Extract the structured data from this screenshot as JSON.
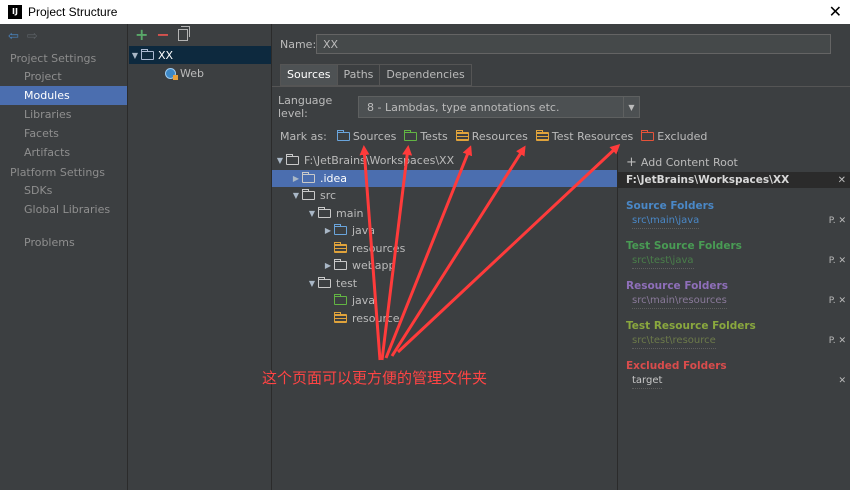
{
  "window": {
    "logo_text": "IJ",
    "title": "Project Structure",
    "close_glyph": "✕"
  },
  "nav": {
    "back_glyph": "⇦",
    "forward_glyph": "⇨",
    "project_settings_header": "Project Settings",
    "project_settings_items": [
      "Project",
      "Modules",
      "Libraries",
      "Facets",
      "Artifacts"
    ],
    "platform_settings_header": "Platform Settings",
    "platform_settings_items": [
      "SDKs",
      "Global Libraries"
    ],
    "problems_label": "Problems",
    "selected_item": "Modules"
  },
  "modules": {
    "toolbar": {
      "add_glyph": "+",
      "remove_glyph": "−"
    },
    "tree": [
      {
        "label": "XX",
        "expanded": true,
        "selected": true,
        "icon": "module-folder-icon"
      },
      {
        "label": "Web",
        "icon": "web-facet-icon"
      }
    ]
  },
  "main": {
    "name_label": "Name:",
    "name_value": "XX",
    "tabs": [
      "Sources",
      "Paths",
      "Dependencies"
    ],
    "active_tab": "Sources",
    "language_level_label": "Language level:",
    "language_level_value": "8 - Lambdas, type annotations etc.",
    "mark_as_label": "Mark as:",
    "mark_as_buttons": [
      {
        "label": "Sources",
        "color": "#6aa5dc"
      },
      {
        "label": "Tests",
        "color": "#62b543"
      },
      {
        "label": "Resources",
        "color": "#e0a33b"
      },
      {
        "label": "Test Resources",
        "color": "#e0a33b"
      },
      {
        "label": "Excluded",
        "color": "#e5533a"
      }
    ]
  },
  "file_tree": [
    {
      "label": "F:\\JetBrains\\Workspaces\\XX",
      "depth": 0,
      "toggle": "▼",
      "icon": "folder"
    },
    {
      "label": ".idea",
      "depth": 1,
      "toggle": "▶",
      "icon": "folder",
      "selected": true
    },
    {
      "label": "src",
      "depth": 1,
      "toggle": "▼",
      "icon": "folder"
    },
    {
      "label": "main",
      "depth": 2,
      "toggle": "▼",
      "icon": "folder"
    },
    {
      "label": "java",
      "depth": 3,
      "toggle": "▶",
      "icon": "source-folder"
    },
    {
      "label": "resources",
      "depth": 3,
      "toggle": "",
      "icon": "resource-folder"
    },
    {
      "label": "webapp",
      "depth": 3,
      "toggle": "▶",
      "icon": "folder"
    },
    {
      "label": "test",
      "depth": 2,
      "toggle": "▼",
      "icon": "folder"
    },
    {
      "label": "java",
      "depth": 3,
      "toggle": "",
      "icon": "test-folder"
    },
    {
      "label": "resource",
      "depth": 3,
      "toggle": "",
      "icon": "resource-folder"
    }
  ],
  "content_root": {
    "add_label": "Add Content Root",
    "root_path": "F:\\JetBrains\\Workspaces\\XX",
    "categories": [
      {
        "title": "Source Folders",
        "path": "src\\main\\java",
        "kind": "src"
      },
      {
        "title": "Test Source Folders",
        "path": "src\\test\\java",
        "kind": "test"
      },
      {
        "title": "Resource Folders",
        "path": "src\\main\\resources",
        "kind": "res"
      },
      {
        "title": "Test Resource Folders",
        "path": "src\\test\\resource",
        "kind": "tres"
      },
      {
        "title": "Excluded Folders",
        "path": "target",
        "kind": "exc"
      }
    ]
  },
  "annotation": {
    "text": "这个页面可以更方便的管理文件夹",
    "color": "#ff3b3b"
  }
}
